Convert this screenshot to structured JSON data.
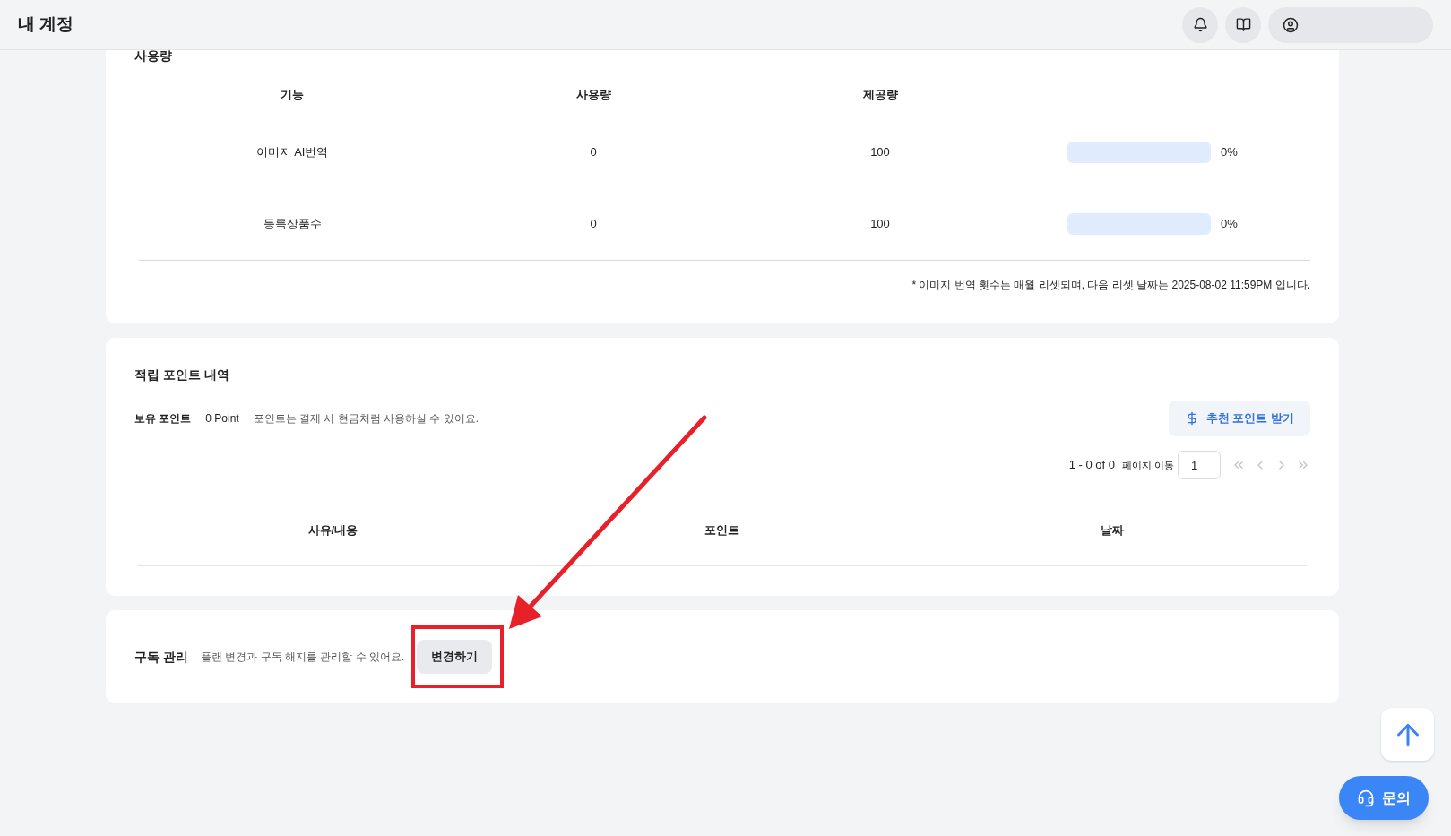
{
  "header": {
    "title": "내 계정"
  },
  "usage": {
    "title": "사용량",
    "columns": [
      "기능",
      "사용량",
      "제공량"
    ],
    "rows": [
      {
        "feature": "이미지 AI번역",
        "used": "0",
        "provided": "100",
        "level": 0,
        "percent": "0%"
      },
      {
        "feature": "등록상품수",
        "used": "0",
        "provided": "100",
        "level": 0,
        "percent": "0%"
      }
    ],
    "note": "* 이미지 번역 횟수는 매월 리셋되며, 다음 리셋 날짜는 2025-08-02 11:59PM 입니다."
  },
  "points": {
    "title": "적립 포인트 내역",
    "held_label": "보유 포인트",
    "held_value": "0 Point",
    "description": "포인트는 결제 시 현금처럼 사용하실 수 있어요.",
    "referral_button": "추천 포인트 받기",
    "range": "1 - 0 of 0",
    "page_jump_label": "페이지 이동",
    "page_value": "1",
    "columns": [
      "사유/내용",
      "포인트",
      "날짜"
    ]
  },
  "subscription": {
    "title": "구독 관리",
    "description": "플랜 변경과 구독 해지를 관리할 수 있어요.",
    "button": "변경하기"
  },
  "inquiry_button": "문의"
}
